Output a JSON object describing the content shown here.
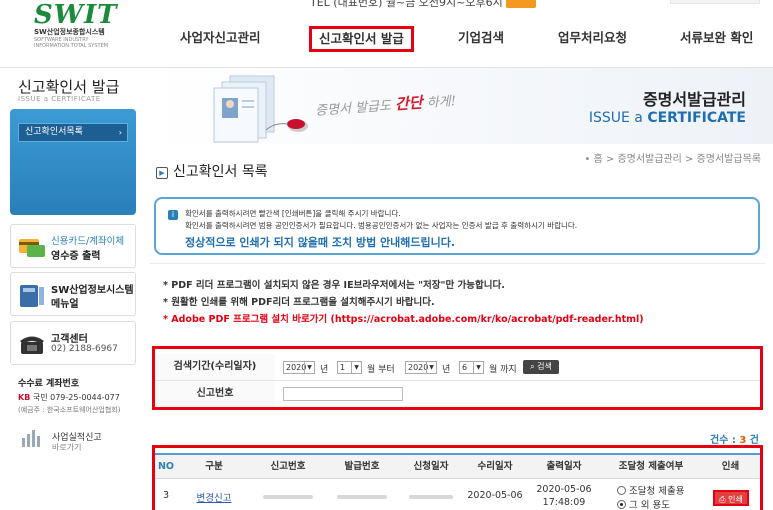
{
  "logo": {
    "mark": "SWIT",
    "kr": "SW산업정보종합시스템",
    "en1": "SOFTWARE INDUSTRY",
    "en2": "INFORMATION TOTAL SYSTEM"
  },
  "topbar": {
    "text": "TEL (대표번호) 월~금 오전9시~오후6시"
  },
  "nav": {
    "items": [
      "사업자신고관리",
      "신고확인서 발급",
      "기업검색",
      "업무처리요청",
      "서류보완 확인"
    ],
    "active_index": 1
  },
  "sidebar": {
    "title": "신고확인서 발급",
    "subtitle": "ISSUE a CERTIFICATE",
    "menu_item": "신고확인서목록",
    "card_receipt": {
      "line1": "신용카드/계좌이체",
      "line2": "영수증 출력"
    },
    "card_sw": {
      "line1": "SW산업정보시스템",
      "line2": "메뉴얼"
    },
    "card_support": {
      "line1": "고객센터",
      "phone": "02) 2188-6967"
    },
    "account": {
      "title": "수수료 계좌번호",
      "bank": "KB",
      "bank_name": "국민",
      "number": "079-25-0044-077",
      "holder": "(예금주 : 한국소프트웨어산업협회)"
    },
    "perf": {
      "line1": "사업실적신고",
      "line2": "바로가기"
    }
  },
  "banner": {
    "slogan": "증명서 발급도",
    "slogan_em": "간단",
    "slogan_tail": "하게!",
    "title": "증명서발급관리",
    "sub_pre": "ISSUE a ",
    "sub_bold": "CERTIFICATE"
  },
  "page": {
    "title": "신고확인서 목록",
    "breadcrumb": "• 홈 > 증명서발급관리 > 증명서발급목록"
  },
  "notice": {
    "line1": "확인서를 출력하시려면 빨간색 [인쇄버튼]을 클릭해 주시기 바랍니다.",
    "line2": "확인서를 출력하시려면 범용 공인인증서가 필요합니다. 범용공인인증서가 없는 사업자는 인증서 발급 후 출력하시기 바랍니다.",
    "line3": "정상적으로 인쇄가 되지 않을때 조치 방법 안내해드립니다."
  },
  "notes": [
    "* PDF 리더 프로그램이 설치되지 않은 경우 IE브라우저에서는 \"저장\"만 가능합니다.",
    "* 원활한 인쇄를 위해 PDF리더 프로그램을 설치해주시기 바랍니다.",
    "* Adobe PDF 프로그램 설치 바로가기 (https://acrobat.adobe.com/kr/ko/acrobat/pdf-reader.html)"
  ],
  "search": {
    "period_label": "검색기간(수리일자)",
    "start_year": "2020",
    "year_unit": "년",
    "start_month": "1",
    "month_from": "월 부터",
    "end_year": "2020",
    "end_month": "6",
    "month_to": "월 까지",
    "button": "검색",
    "number_label": "신고번호",
    "number_value": ""
  },
  "table": {
    "count_label": "건수 : ",
    "count_value": "3",
    "count_unit": " 건",
    "headers": [
      "NO",
      "구분",
      "신고번호",
      "발급번호",
      "신청일자",
      "수리일자",
      "출력일자",
      "조달청 제출여부",
      "인쇄"
    ],
    "rows": [
      {
        "no": "3",
        "type": "변경신고",
        "received": "2020-05-06",
        "printed_date": "2020-05-06",
        "printed_time": "17:48:09",
        "opt1": "조달청 제출용",
        "opt2": "그 외 용도",
        "print": "인쇄"
      }
    ]
  },
  "colors": {
    "accent_red": "#e60012",
    "brand_green": "#1a8b3c",
    "blue": "#2a7fb9"
  }
}
